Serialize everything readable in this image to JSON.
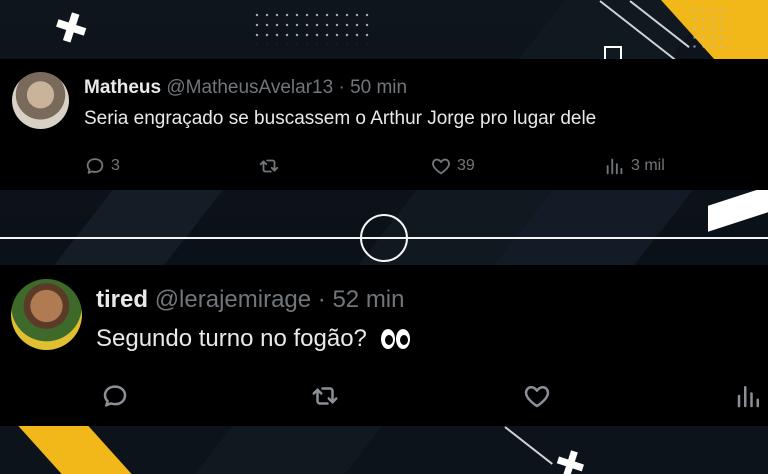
{
  "tweets": [
    {
      "display_name": "Matheus",
      "handle": "@MatheusAvelar13",
      "separator": "·",
      "time": "50 min",
      "text": "Seria engraçado se buscassem o Arthur Jorge pro lugar dele",
      "replies": "3",
      "retweets": "",
      "likes": "39",
      "views": "3 mil",
      "icons": [
        "reply-icon",
        "retweet-icon",
        "like-icon",
        "views-icon"
      ]
    },
    {
      "display_name": "tired",
      "handle": "@lerajemirage",
      "separator": "·",
      "time": "52 min",
      "text": "Segundo turno no fogão?",
      "emoji": "eyes",
      "replies": "",
      "retweets": "",
      "likes": "",
      "views": "",
      "icons": [
        "reply-icon",
        "retweet-icon",
        "like-icon",
        "views-icon"
      ]
    }
  ],
  "colors": {
    "card_background": "#000000",
    "primary_text": "#e7e9ea",
    "secondary_text": "#71767b",
    "accent_yellow": "#f2b81a",
    "page_background": "#0b1016"
  }
}
